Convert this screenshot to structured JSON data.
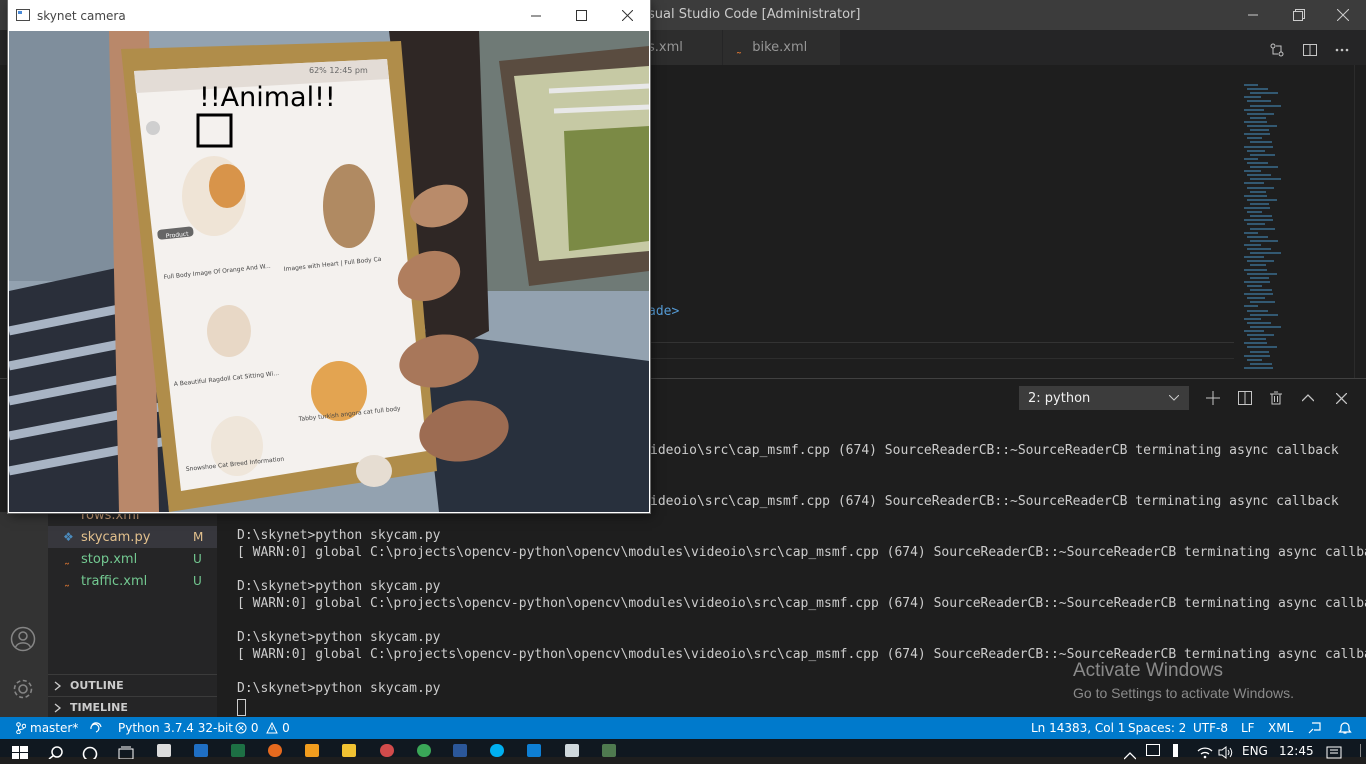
{
  "vscode": {
    "title": "sual Studio Code [Administrator]",
    "tabs": [
      {
        "label": "s.xml"
      },
      {
        "label": "bike.xml"
      }
    ],
    "editor_fragment": "ade>"
  },
  "panel": {
    "terminal_select": "2: python",
    "lines": [
      "ideoio\\src\\cap_msmf.cpp (674) SourceReaderCB::~SourceReaderCB terminating async callback",
      "ideoio\\src\\cap_msmf.cpp (674) SourceReaderCB::~SourceReaderCB terminating async callback",
      "D:\\skynet>python skycam.py",
      "[ WARN:0] global C:\\projects\\opencv-python\\opencv\\modules\\videoio\\src\\cap_msmf.cpp (674) SourceReaderCB::~SourceReaderCB terminating async callback",
      "D:\\skynet>python skycam.py",
      "[ WARN:0] global C:\\projects\\opencv-python\\opencv\\modules\\videoio\\src\\cap_msmf.cpp (674) SourceReaderCB::~SourceReaderCB terminating async callback",
      "D:\\skynet>python skycam.py",
      "[ WARN:0] global C:\\projects\\opencv-python\\opencv\\modules\\videoio\\src\\cap_msmf.cpp (674) SourceReaderCB::~SourceReaderCB terminating async callback",
      "D:\\skynet>python skycam.py"
    ]
  },
  "sidebar": {
    "files": [
      {
        "name": "rows.xml",
        "status": ""
      },
      {
        "name": "skycam.py",
        "status": "M"
      },
      {
        "name": "stop.xml",
        "status": "U"
      },
      {
        "name": "traffic.xml",
        "status": "U"
      }
    ],
    "outline": "OUTLINE",
    "timeline": "TIMELINE"
  },
  "statusbar": {
    "branch": "master*",
    "python": "Python 3.7.4 32-bit",
    "errors": "0",
    "warnings": "0",
    "position": "Ln 14383, Col 1",
    "spaces": "Spaces: 2",
    "encoding": "UTF-8",
    "eol": "LF",
    "language": "XML"
  },
  "watermark": {
    "line1": "Activate Windows",
    "line2": "Go to Settings to activate Windows."
  },
  "taskbar": {
    "lang": "ENG",
    "time": "12:45"
  },
  "camera": {
    "title": "skynet camera",
    "detection_label": "!!Animal!!",
    "phone": {
      "status": "62% 12:45 pm",
      "captions": [
        "Full Body Image Of Orange And W...",
        "Images with Heart | Full Body Ca",
        "A Beautiful Ragdoll Cat Sitting Wi...",
        "Tabby turkish angora cat full body",
        "Snowshoe Cat Breed Information"
      ],
      "product_badge": "Product"
    }
  },
  "colors": {
    "accent": "#007acc",
    "xml_icon": "#e37933",
    "modified": "#e2c08d",
    "untracked": "#73c991"
  }
}
